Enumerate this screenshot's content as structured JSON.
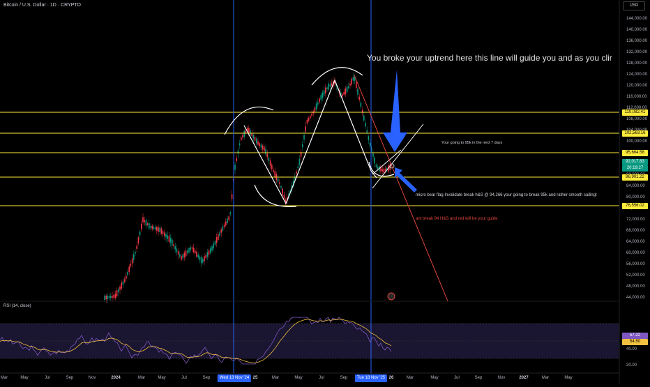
{
  "header": {
    "symbol_title": "Bitcoin / U.S. Dollar · 1D · CRYPTO",
    "currency": "USD"
  },
  "price_axis": {
    "labels": [
      "144,000.00",
      "140,000.00",
      "136,000.00",
      "132,000.00",
      "128,000.00",
      "124,000.00",
      "120,000.00",
      "116,000.00",
      "112,000.00",
      "108,000.00",
      "104,000.00",
      "100,000.00",
      "96,000.00",
      "92,000.00",
      "88,000.00",
      "84,000.00",
      "80,000.00",
      "76,000.00",
      "72,000.00",
      "68,000.00",
      "64,000.00",
      "60,000.00",
      "56,000.00",
      "52,000.00",
      "48,000.00",
      "44,000.00"
    ]
  },
  "price_tags": {
    "level_1": "110,082.41",
    "level_2": "102,563.16",
    "level_3": "95,664.58",
    "current_price": "92,017.83",
    "countdown": "20:19:27",
    "level_4": "86,901.22",
    "level_5": "76,556.02"
  },
  "rsi": {
    "label": "RSI (14, close)",
    "value": "57.22",
    "ma_value": "54.50",
    "axis": [
      "60.00",
      "40.00",
      "20.00"
    ],
    "colors": {
      "rsi": "#7e57c2",
      "ma": "#f0c040",
      "band": "#1a1530"
    }
  },
  "time_axis": {
    "ticks": [
      {
        "label": "Mar",
        "bold": false
      },
      {
        "label": "May",
        "bold": false
      },
      {
        "label": "Jul",
        "bold": false
      },
      {
        "label": "Sep",
        "bold": false
      },
      {
        "label": "Nov",
        "bold": false
      },
      {
        "label": "2024",
        "bold": true
      },
      {
        "label": "Mar",
        "bold": false
      },
      {
        "label": "May",
        "bold": false
      },
      {
        "label": "Jul",
        "bold": false
      },
      {
        "label": "Sep",
        "bold": false
      },
      {
        "label": "25",
        "bold": true
      },
      {
        "label": "Mar",
        "bold": false
      },
      {
        "label": "May",
        "bold": false
      },
      {
        "label": "Jul",
        "bold": false
      },
      {
        "label": "Sep",
        "bold": false
      },
      {
        "label": "26",
        "bold": true
      },
      {
        "label": "Mar",
        "bold": false
      },
      {
        "label": "May",
        "bold": false
      },
      {
        "label": "Jul",
        "bold": false
      },
      {
        "label": "Sep",
        "bold": false
      },
      {
        "label": "Nov",
        "bold": false
      },
      {
        "label": "2027",
        "bold": true
      },
      {
        "label": "Mar",
        "bold": false
      },
      {
        "label": "May",
        "bold": false
      }
    ],
    "date_marker_1": "Wed 13 Nov '24",
    "date_marker_2": "Tue 18 Nov '25"
  },
  "annotations": {
    "uptrend_text": "You broke your uptrend here this line will guide you and as you clir",
    "seven_days_text": "Your going to 95k in the next 7 days",
    "micro_flag_text": "micro bear flag  Invalidate  break h&S @ 94,266 your going to break 95k and rather smooth sailingt",
    "red_guide_text": "ant break 94 H&S and red will be your guide"
  },
  "colors": {
    "background": "#000000",
    "level_line": "#ffeb3b",
    "vertical_marker": "#2962ff",
    "trend_line": "#e0443a",
    "arrow": "#2962ff",
    "candle_up": "#089981",
    "candle_down": "#f23645",
    "drawing": "#ffffff"
  }
}
